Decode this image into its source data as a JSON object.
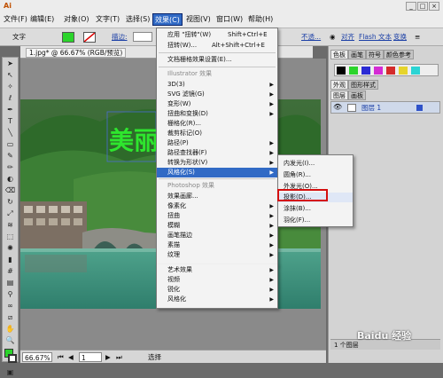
{
  "menubar": {
    "items": [
      "文件(F)",
      "编辑(E)",
      "对象(O)",
      "文字(T)",
      "选择(S)",
      "效果(C)",
      "视图(V)",
      "窗口(W)",
      "帮助(H)"
    ],
    "active_index": 5
  },
  "control": {
    "type_label": "文字",
    "stroke_label": "描边:",
    "opacity_label": "不透...",
    "align_label": "对齐",
    "flash_text_label": "Flash 文本",
    "transform_label": "变换",
    "fill_color": "#2bd42b"
  },
  "document": {
    "tab_label": "1.jpg* @ 66.67% (RGB/预览)",
    "overlay_text": "美丽",
    "overlay_color": "#2ee62e"
  },
  "status": {
    "zoom": "66.67%",
    "page": "1",
    "mode": "选择"
  },
  "effect_menu": {
    "items": [
      {
        "label": "应用 \"扭转\"(W)",
        "shortcut": "Shift+Ctrl+E"
      },
      {
        "label": "扭转(W)...",
        "shortcut": "Alt+Shift+Ctrl+E"
      },
      {
        "label": "文档栅格效果设置(E)..."
      },
      {
        "label": "Illustrator 效果",
        "header": true
      },
      {
        "label": "3D(3)",
        "arrow": true
      },
      {
        "label": "SVG 滤镜(G)",
        "arrow": true
      },
      {
        "label": "变形(W)",
        "arrow": true
      },
      {
        "label": "扭曲和变换(D)",
        "arrow": true
      },
      {
        "label": "栅格化(R)..."
      },
      {
        "label": "裁剪标记(O)"
      },
      {
        "label": "路径(P)",
        "arrow": true
      },
      {
        "label": "路径查找器(F)",
        "arrow": true
      },
      {
        "label": "转换为形状(V)",
        "arrow": true
      },
      {
        "label": "风格化(S)",
        "arrow": true,
        "highlight": true
      },
      {
        "label": "Photoshop 效果",
        "header": true
      },
      {
        "label": "效果画廊..."
      },
      {
        "label": "像素化",
        "arrow": true
      },
      {
        "label": "扭曲",
        "arrow": true
      },
      {
        "label": "模糊",
        "arrow": true
      },
      {
        "label": "画笔描边",
        "arrow": true
      },
      {
        "label": "素描",
        "arrow": true
      },
      {
        "label": "纹理",
        "arrow": true
      },
      {
        "label": "艺术效果",
        "arrow": true
      },
      {
        "label": "视频",
        "arrow": true
      },
      {
        "label": "锐化",
        "arrow": true
      },
      {
        "label": "风格化",
        "arrow": true
      }
    ]
  },
  "stylize_submenu": {
    "items": [
      {
        "label": "内发光(I)..."
      },
      {
        "label": "圆角(R)..."
      },
      {
        "label": "外发光(O)..."
      },
      {
        "label": "投影(D)...",
        "selected": true
      },
      {
        "label": "涂抹(B)..."
      },
      {
        "label": "羽化(F)..."
      }
    ]
  },
  "panels": {
    "swatch_tabs": [
      "色板",
      "画笔",
      "符号",
      "颜色参考"
    ],
    "appearance_tabs": [
      "外观",
      "图形样式"
    ],
    "layers_tabs": [
      "图层",
      "画板"
    ],
    "layer_name": "图层 1",
    "layer_count": "1",
    "layer_footer": "1 个图层"
  },
  "watermark": "Baidu 经验"
}
